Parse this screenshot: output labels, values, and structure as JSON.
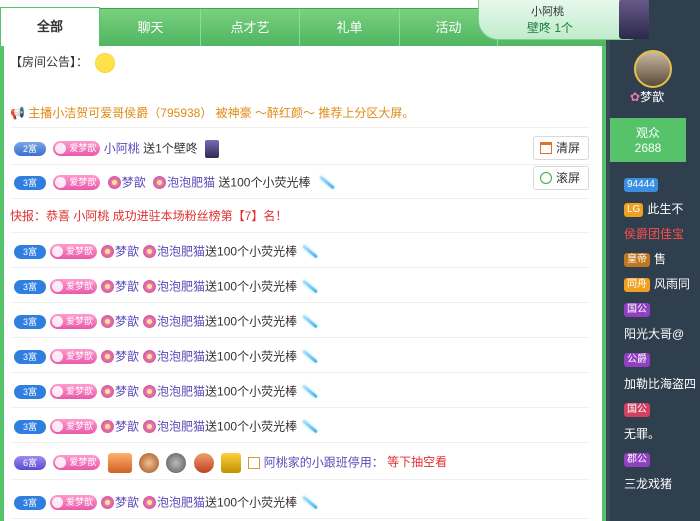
{
  "tabs": [
    "全部",
    "聊天",
    "点才艺",
    "礼单",
    "活动"
  ],
  "announcement": {
    "label": "【房间公告】：",
    "emoji": "grin-emoji"
  },
  "announce_line": "主播小洁贺可爱哥侯爵（795938） 被神豪 ～醉红颜～ 推荐上分区大屏。",
  "controls": {
    "clear": "清屏",
    "scroll": "滚屏"
  },
  "rows": [
    {
      "rich": "2富",
      "fan": "爱梦歆",
      "nick": "小阿桃",
      "text": "送1个壁咚"
    },
    {
      "rich": "3富",
      "fan": "爱梦歆",
      "nick1": "梦歆",
      "nick2": "泡泡肥猫",
      "text": "送100个小荧光棒"
    }
  ],
  "alert_line": "快报：恭喜 小阿桃 成功进驻本场粉丝榜第【7】名！",
  "repeat_row": {
    "rich": "3富",
    "fan": "爱梦歆",
    "nick1": "梦歆",
    "nick2": "泡泡肥猫",
    "text": "送100个小荧光棒"
  },
  "special_row": {
    "rich": "6富",
    "fan": "爱梦歆",
    "nick": "阿桃家的小跟班停用：",
    "text": "等下抽空看"
  },
  "popup": {
    "name": "小阿桃",
    "gift": "壁咚 1个"
  },
  "anchor": {
    "name": "梦歆"
  },
  "audience": {
    "label": "观众",
    "count": "2688"
  },
  "users": [
    {
      "badge": "94444",
      "text": ""
    },
    {
      "badge": "LG",
      "text": "此生不"
    },
    {
      "badge": "",
      "text": "侯爵团佳宝"
    },
    {
      "badge": "皇帝",
      "text": "售"
    },
    {
      "badge": "同舟",
      "text": "风雨同"
    },
    {
      "badge": "国公",
      "text": ""
    },
    {
      "badge": "",
      "text": "阳光大哥@"
    },
    {
      "badge": "公爵",
      "text": ""
    },
    {
      "badge": "",
      "text": "加勒比海盗四"
    },
    {
      "badge": "国公",
      "text": ""
    },
    {
      "badge": "",
      "text": "无罪。"
    },
    {
      "badge": "郡公",
      "text": ""
    },
    {
      "badge": "",
      "text": "三龙戏猪"
    }
  ],
  "colors": {
    "green": "#56c26a",
    "announce": "#e08a10",
    "alert": "#e03030",
    "nick": "#5b4bb8"
  }
}
